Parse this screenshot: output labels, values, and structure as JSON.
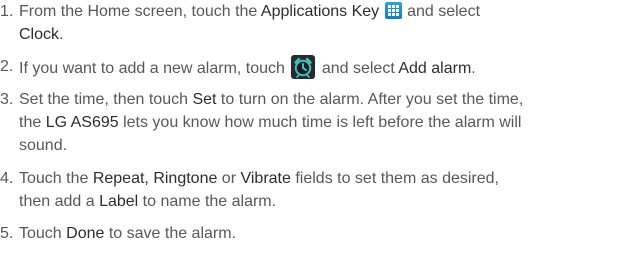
{
  "steps": [
    {
      "number": "1.",
      "line1": {
        "t1": "From the Home screen, touch the ",
        "b1": "Applications Key",
        "t2": " and select"
      },
      "line2": {
        "b1": "Clock",
        "t1": "."
      }
    },
    {
      "number": "2.",
      "line1": {
        "t1": "If you want to add a new alarm, touch",
        "t2": " and select ",
        "b1": "Add alarm",
        "t3": "."
      }
    },
    {
      "number": "3.",
      "line1": {
        "t1": "Set the time, then touch ",
        "b1": "Set",
        "t2": " to turn on the alarm. After you set the time,"
      },
      "line2": {
        "t1": "the ",
        "b1": "LG AS695",
        "t2": " lets you know how much time is left before the alarm will"
      },
      "line3": {
        "t1": "sound."
      }
    },
    {
      "number": "4.",
      "line1": {
        "t1": "Touch the ",
        "b1": "Repeat, Ringtone",
        "t2": " or ",
        "b2": "Vibrate",
        "t3": " fields to set them as desired,"
      },
      "line2": {
        "t1": "then add a ",
        "b1": "Label",
        "t2": " to name the alarm."
      }
    },
    {
      "number": "5.",
      "line1": {
        "t1": "Touch ",
        "b1": "Done",
        "t2": " to save the alarm."
      }
    }
  ],
  "icons": {
    "applications_key": "apps-grid-icon",
    "add_alarm": "alarm-clock-icon"
  },
  "colors": {
    "body_text": "#585858",
    "emphasis_text": "#2d2d2d",
    "apps_icon_blue": "#1b93d3",
    "alarm_icon_teal": "#2aa7a7"
  }
}
